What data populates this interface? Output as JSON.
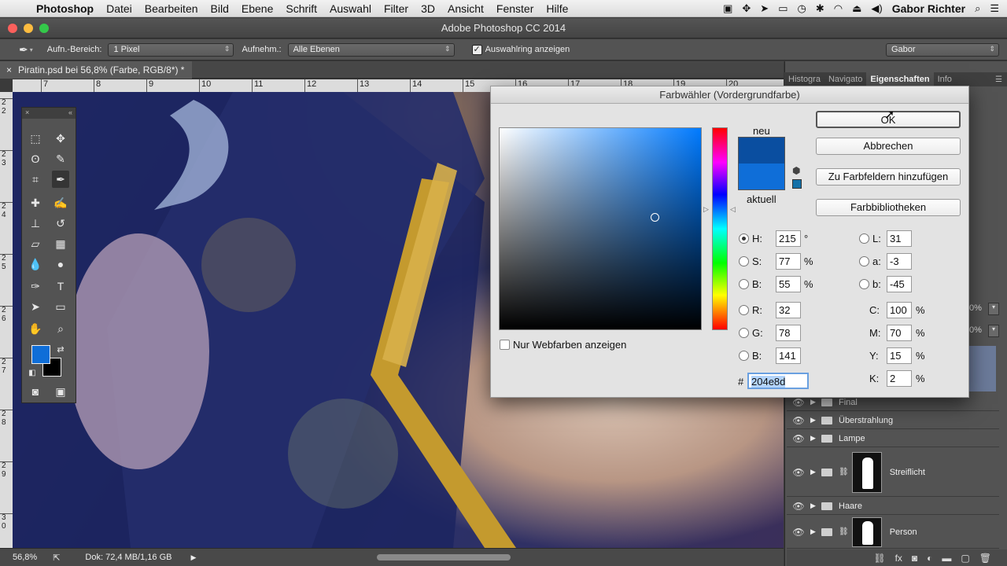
{
  "menubar": {
    "apple": "",
    "items": [
      "Photoshop",
      "Datei",
      "Bearbeiten",
      "Bild",
      "Ebene",
      "Schrift",
      "Auswahl",
      "Filter",
      "3D",
      "Ansicht",
      "Fenster",
      "Hilfe"
    ],
    "user": "Gabor Richter"
  },
  "window": {
    "title": "Adobe Photoshop CC 2014"
  },
  "options": {
    "sample_size_label": "Aufn.-Bereich:",
    "sample_size_value": "1 Pixel",
    "sample_label": "Aufnehm.:",
    "sample_value": "Alle Ebenen",
    "show_ring_label": "Auswahlring anzeigen",
    "workspace": "Gabor"
  },
  "document": {
    "tab_title": "Piratin.psd bei 56,8% (Farbe, RGB/8*) *",
    "close": "×"
  },
  "ruler_top": [
    "7",
    "8",
    "9",
    "10",
    "11",
    "12",
    "13",
    "14",
    "15",
    "16",
    "17",
    "18",
    "19",
    "20"
  ],
  "ruler_left": [
    "2",
    "2",
    "2",
    "3",
    "2",
    "4",
    "2",
    "5",
    "2",
    "6",
    "2",
    "7",
    "2",
    "8",
    "2",
    "9",
    "3",
    "0"
  ],
  "status": {
    "zoom": "56,8%",
    "doc": "Dok: 72,4 MB/1,16 GB"
  },
  "panels": {
    "tabs": [
      "Histogra",
      "Navigato",
      "Eigenschaften",
      "Info"
    ],
    "percent_1": "0%",
    "percent_2": "0%"
  },
  "layers": [
    {
      "name": "Final",
      "mask": false
    },
    {
      "name": "Überstrahlung",
      "mask": false
    },
    {
      "name": "Lampe",
      "mask": false
    },
    {
      "name": "Streiflicht",
      "mask": true
    },
    {
      "name": "Haare",
      "mask": false
    },
    {
      "name": "Person",
      "mask": true
    }
  ],
  "color_picker": {
    "title": "Farbwähler (Vordergrundfarbe)",
    "new_label": "neu",
    "current_label": "aktuell",
    "new_color": "#0a4ea0",
    "current_color": "#0f6ed8",
    "buttons": {
      "ok": "OK",
      "cancel": "Abbrechen",
      "add_swatch": "Zu Farbfeldern hinzufügen",
      "libraries": "Farbbibliotheken"
    },
    "web_only_label": "Nur Webfarben anzeigen",
    "hsb": {
      "H": "215",
      "S": "77",
      "B": "55",
      "h_unit": "°",
      "s_unit": "%",
      "b_unit": "%"
    },
    "rgb": {
      "R": "32",
      "G": "78",
      "B": "141"
    },
    "lab": {
      "L": "31",
      "a": "-3",
      "b": "-45"
    },
    "cmyk": {
      "C": "100",
      "M": "70",
      "Y": "15",
      "K": "2",
      "unit": "%"
    },
    "hex_label": "#",
    "hex": "204e8d",
    "labels": {
      "H": "H:",
      "S": "S:",
      "Bh": "B:",
      "R": "R:",
      "G": "G:",
      "Bb": "B:",
      "L": "L:",
      "a": "a:",
      "b": "b:",
      "C": "C:",
      "M": "M:",
      "Y": "Y:",
      "K": "K:"
    }
  },
  "toolbox": {
    "fg_color": "#0f6ed8",
    "bg_color": "#000000"
  }
}
